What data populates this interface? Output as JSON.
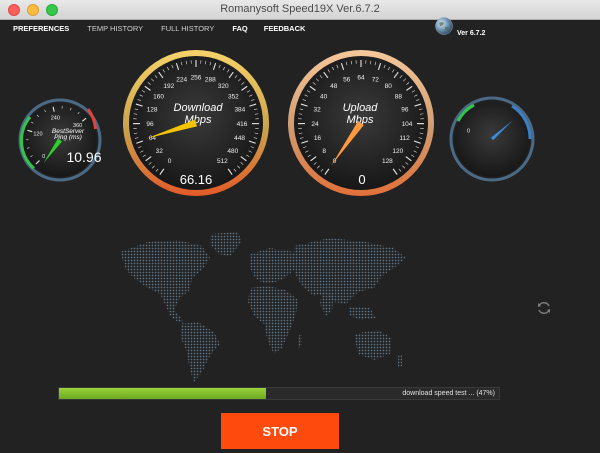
{
  "window": {
    "title": "Romanysoft Speed19X Ver.6.7.2"
  },
  "menu": [
    {
      "label": "PREFERENCES"
    },
    {
      "label": "TEMP HISTORY"
    },
    {
      "label": "FULL HISTORY"
    },
    {
      "label": "FAQ"
    },
    {
      "label": "FEEDBACK"
    }
  ],
  "version": "Ver 6.7.2",
  "gauges": {
    "ping": {
      "label_line1": "BestServer",
      "label_line2": "Ping (ms)",
      "value": "10.96",
      "ticks": [
        "0",
        "120",
        "240",
        "360"
      ],
      "needle_fraction": 0.03
    },
    "download": {
      "label_line1": "Download",
      "label_line2": "Mbps",
      "value": "66.16",
      "ticks": [
        "0",
        "32",
        "64",
        "96",
        "128",
        "160",
        "192",
        "224",
        "256",
        "288",
        "320",
        "352",
        "384",
        "416",
        "448",
        "480",
        "512"
      ],
      "needle_fraction": 0.13
    },
    "upload": {
      "label_line1": "Upload",
      "label_line2": "Mbps",
      "value": "0",
      "ticks": [
        "0",
        "8",
        "16",
        "24",
        "32",
        "40",
        "48",
        "56",
        "64",
        "72",
        "80",
        "88",
        "96",
        "104",
        "112",
        "120",
        "128"
      ],
      "needle_fraction": 0.0
    },
    "extra": {
      "ticks": [
        "0"
      ],
      "needle_fraction": 0.0
    }
  },
  "progress": {
    "fraction": 0.47,
    "text": "download speed test ... (47%)"
  },
  "stop_button": "STOP",
  "colors": {
    "accent": "#ff4a0e",
    "progress": "#7dbf2b",
    "download_needle": "#f5c400",
    "upload_needle": "#ff9a40",
    "ping_needle": "#2ed02e",
    "extra_needle": "#3a8ee0"
  }
}
